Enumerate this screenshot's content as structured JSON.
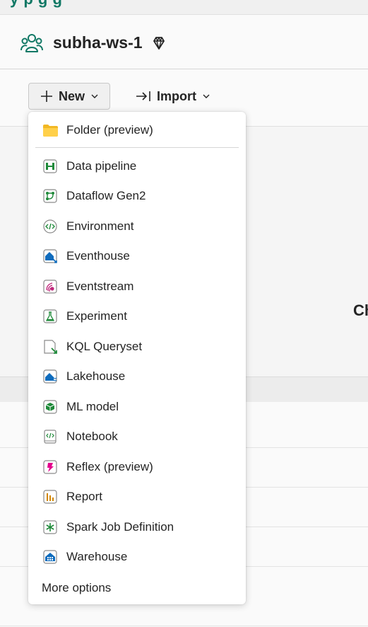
{
  "workspace": {
    "title": "subha-ws-1"
  },
  "toolbar": {
    "new_label": "New",
    "import_label": "Import"
  },
  "background": {
    "right_partial_text": "Ch"
  },
  "menu": {
    "folder_label": "Folder (preview)",
    "items": [
      {
        "label": "Data pipeline",
        "icon": "data-pipeline-icon"
      },
      {
        "label": "Dataflow Gen2",
        "icon": "dataflow-gen2-icon"
      },
      {
        "label": "Environment",
        "icon": "environment-icon"
      },
      {
        "label": "Eventhouse",
        "icon": "eventhouse-icon"
      },
      {
        "label": "Eventstream",
        "icon": "eventstream-icon"
      },
      {
        "label": "Experiment",
        "icon": "experiment-icon"
      },
      {
        "label": "KQL Queryset",
        "icon": "kql-queryset-icon"
      },
      {
        "label": "Lakehouse",
        "icon": "lakehouse-icon"
      },
      {
        "label": "ML model",
        "icon": "ml-model-icon"
      },
      {
        "label": "Notebook",
        "icon": "notebook-icon"
      },
      {
        "label": "Reflex (preview)",
        "icon": "reflex-icon"
      },
      {
        "label": "Report",
        "icon": "report-icon"
      },
      {
        "label": "Spark Job Definition",
        "icon": "spark-job-icon"
      },
      {
        "label": "Warehouse",
        "icon": "warehouse-icon"
      }
    ],
    "more_options_label": "More options"
  },
  "colors": {
    "brand_teal": "#117865",
    "menu_bg": "#ffffff",
    "page_bg": "#f5f5f5"
  }
}
